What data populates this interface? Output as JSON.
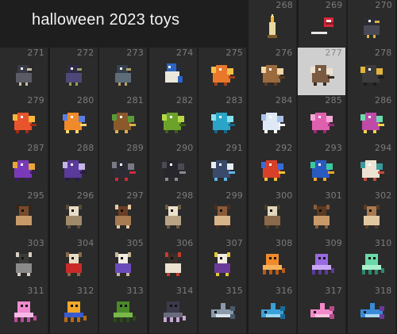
{
  "header": {
    "title": "halloween 2023 toys"
  },
  "selected_item": "277",
  "items": [
    {
      "num": "268",
      "icon": "candle-icon",
      "colors": [
        "#e8d9a0",
        "#f7b733",
        "#7a5b2c"
      ]
    },
    {
      "num": "269",
      "icon": "lollipop-icon",
      "colors": [
        "#d8283c",
        "#f1f1f1",
        "#8e1b24"
      ]
    },
    {
      "num": "270",
      "icon": "crow-icon",
      "colors": [
        "#2c2c34",
        "#4a4a56",
        "#d9b24a"
      ]
    },
    {
      "num": "271",
      "icon": "crow-icon",
      "colors": [
        "#3a3a44",
        "#5b5b66",
        "#c9c0a8"
      ]
    },
    {
      "num": "272",
      "icon": "crow-icon",
      "colors": [
        "#2f2b47",
        "#4e4878",
        "#9ca05a"
      ]
    },
    {
      "num": "273",
      "icon": "crow-icon",
      "colors": [
        "#36404a",
        "#5c6c78",
        "#b7a36a"
      ]
    },
    {
      "num": "274",
      "icon": "bluejay-icon",
      "colors": [
        "#2d64c2",
        "#ebe7dc",
        "#1d2c52"
      ]
    },
    {
      "num": "275",
      "icon": "dragon-icon",
      "colors": [
        "#e9782b",
        "#f5c04a",
        "#a63e1c"
      ]
    },
    {
      "num": "276",
      "icon": "dragon-icon",
      "colors": [
        "#9b6b3e",
        "#f1d6a6",
        "#5a3b22"
      ]
    },
    {
      "num": "277",
      "icon": "dragon-icon",
      "colors": [
        "#7a5a40",
        "#ede2cf",
        "#3a2a1c"
      ]
    },
    {
      "num": "278",
      "icon": "dragon-icon",
      "colors": [
        "#3b3b3b",
        "#e2b43b",
        "#1d1d1d"
      ]
    },
    {
      "num": "279",
      "icon": "dragon-icon",
      "colors": [
        "#e8542c",
        "#f6b93b",
        "#9e2d15"
      ]
    },
    {
      "num": "280",
      "icon": "dragon-icon",
      "colors": [
        "#f08a2a",
        "#5a7fe0",
        "#f5d86a"
      ]
    },
    {
      "num": "281",
      "icon": "dragon-icon",
      "colors": [
        "#8a5a2c",
        "#5a9a3a",
        "#d9b34a"
      ]
    },
    {
      "num": "282",
      "icon": "dragon-icon",
      "colors": [
        "#6ca22a",
        "#b8d84a",
        "#3c5e18"
      ]
    },
    {
      "num": "283",
      "icon": "dragon-icon",
      "colors": [
        "#2aa5c8",
        "#86e0ee",
        "#176784"
      ]
    },
    {
      "num": "284",
      "icon": "dragon-icon",
      "colors": [
        "#dfe9f5",
        "#a8c2e8",
        "#ffffff"
      ]
    },
    {
      "num": "285",
      "icon": "dragon-icon",
      "colors": [
        "#e060b0",
        "#f4a8d8",
        "#9a2a74"
      ]
    },
    {
      "num": "286",
      "icon": "dragon-icon",
      "colors": [
        "#c04aa8",
        "#6adcb0",
        "#f2d34a"
      ]
    },
    {
      "num": "287",
      "icon": "dragon-icon",
      "colors": [
        "#7a3ab8",
        "#e9a63a",
        "#3a1c5e"
      ]
    },
    {
      "num": "288",
      "icon": "dragon-icon",
      "colors": [
        "#5a3a9a",
        "#c4b4e8",
        "#2a1a4a"
      ]
    },
    {
      "num": "289",
      "icon": "dragon-icon",
      "colors": [
        "#2c2c34",
        "#7a7a86",
        "#d02a3a"
      ]
    },
    {
      "num": "290",
      "icon": "dragon-icon",
      "colors": [
        "#26262c",
        "#4a4a54",
        "#8a8a94"
      ]
    },
    {
      "num": "291",
      "icon": "dragon-icon",
      "colors": [
        "#3a4a6a",
        "#e8ecf5",
        "#5ab8e8"
      ]
    },
    {
      "num": "292",
      "icon": "dragon-icon",
      "colors": [
        "#d8402a",
        "#3a6ad8",
        "#f2c23a"
      ]
    },
    {
      "num": "293",
      "icon": "dragon-icon",
      "colors": [
        "#2a5ac0",
        "#3ac8a0",
        "#f2a62a"
      ]
    },
    {
      "num": "294",
      "icon": "dragon-icon",
      "colors": [
        "#ece3d2",
        "#3a9a9a",
        "#c84a3a"
      ]
    },
    {
      "num": "295",
      "icon": "goat-icon",
      "colors": [
        "#7a4a2c",
        "#c89a6a",
        "#3a2416"
      ]
    },
    {
      "num": "296",
      "icon": "goat-icon",
      "colors": [
        "#e8dcc4",
        "#a08a6a",
        "#5a4a3a"
      ]
    },
    {
      "num": "297",
      "icon": "goat-icon",
      "colors": [
        "#6a3e26",
        "#a87a52",
        "#e8c8a0"
      ]
    },
    {
      "num": "298",
      "icon": "goat-icon",
      "colors": [
        "#ece2cc",
        "#b8a484",
        "#6a5a44"
      ]
    },
    {
      "num": "299",
      "icon": "goat-icon",
      "colors": [
        "#8a5a3a",
        "#d8b48a",
        "#4a2e1c"
      ]
    },
    {
      "num": "300",
      "icon": "goat-icon",
      "colors": [
        "#e2d6bc",
        "#8a6a4a",
        "#4a3a2a"
      ]
    },
    {
      "num": "301",
      "icon": "goat-icon",
      "colors": [
        "#5a3a22",
        "#c89a6a",
        "#8a5a3a"
      ]
    },
    {
      "num": "302",
      "icon": "goat-icon",
      "colors": [
        "#a87a52",
        "#e2c8a0",
        "#5a3a22"
      ]
    },
    {
      "num": "303",
      "icon": "goat-icon",
      "colors": [
        "#3a3a3a",
        "#8a8a8a",
        "#d8d0c0"
      ]
    },
    {
      "num": "304",
      "icon": "goat-icon",
      "colors": [
        "#e8dcc4",
        "#c82a2a",
        "#8a6a4a"
      ]
    },
    {
      "num": "305",
      "icon": "goat-icon",
      "colors": [
        "#f2ece0",
        "#6a4ab8",
        "#c8b89a"
      ]
    },
    {
      "num": "306",
      "icon": "goat-icon",
      "colors": [
        "#3a2e26",
        "#ece2d0",
        "#c83a2a"
      ]
    },
    {
      "num": "307",
      "icon": "goat-icon",
      "colors": [
        "#f2ece0",
        "#6a3a9a",
        "#e8c83a"
      ]
    },
    {
      "num": "308",
      "icon": "octopus-icon",
      "colors": [
        "#f08a2a",
        "#f6b25a",
        "#b85a14"
      ]
    },
    {
      "num": "309",
      "icon": "octopus-icon",
      "colors": [
        "#9a6ae0",
        "#c8a8f5",
        "#5a3a9a"
      ]
    },
    {
      "num": "310",
      "icon": "octopus-icon",
      "colors": [
        "#6ad8a8",
        "#a8f0cc",
        "#2a8a6a"
      ]
    },
    {
      "num": "311",
      "icon": "octopus-icon",
      "colors": [
        "#f08ad0",
        "#f6b8e6",
        "#b84a9a"
      ]
    },
    {
      "num": "312",
      "icon": "octopus-icon",
      "colors": [
        "#f2a82a",
        "#3a5ad0",
        "#b86a14"
      ]
    },
    {
      "num": "313",
      "icon": "octopus-icon",
      "colors": [
        "#4a8a2a",
        "#7ab84a",
        "#2a4a1a"
      ]
    },
    {
      "num": "314",
      "icon": "octopus-icon",
      "colors": [
        "#3a3a4a",
        "#6a6a7a",
        "#c8a8d8"
      ]
    },
    {
      "num": "315",
      "icon": "shark-icon",
      "colors": [
        "#8a9aaa",
        "#dce4ec",
        "#4a5a6a"
      ]
    },
    {
      "num": "316",
      "icon": "shark-icon",
      "colors": [
        "#3aa0d8",
        "#9ad8f2",
        "#1a6a9a"
      ]
    },
    {
      "num": "317",
      "icon": "shark-icon",
      "colors": [
        "#f08ac8",
        "#f8c4e2",
        "#b84a8a"
      ]
    },
    {
      "num": "318",
      "icon": "shark-icon",
      "colors": [
        "#3a8ad8",
        "#a8d8f2",
        "#6a3a9a"
      ]
    }
  ]
}
